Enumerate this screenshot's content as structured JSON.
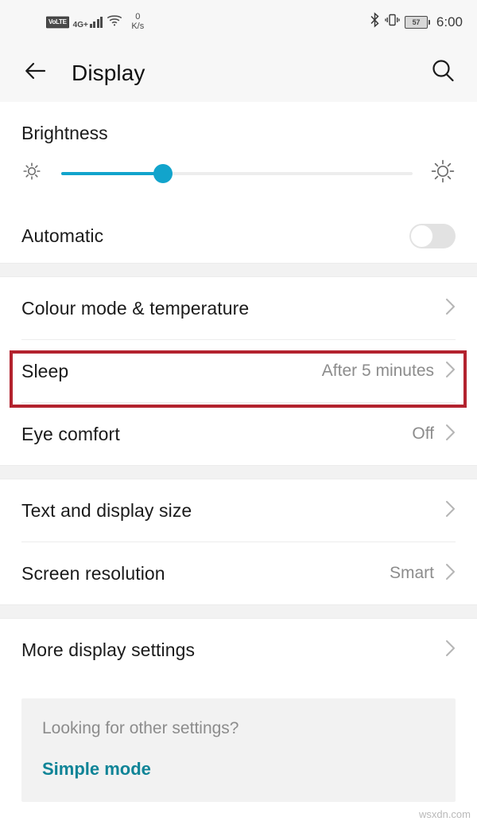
{
  "status_bar": {
    "volte_label": "VoLTE",
    "network_type": "4G+",
    "signal_icon": "signal-bars-icon",
    "wifi_icon": "wifi-icon",
    "network_speed_value": "0",
    "network_speed_unit": "K/s",
    "bluetooth_icon": "bluetooth-icon",
    "vibrate_icon": "vibrate-icon",
    "battery_percent": "57",
    "time": "6:00"
  },
  "app_bar": {
    "back_icon": "back-arrow-icon",
    "title": "Display",
    "search_icon": "search-icon"
  },
  "brightness": {
    "label": "Brightness",
    "low_icon": "brightness-low-sun-icon",
    "high_icon": "brightness-high-sun-icon",
    "slider_percent": 29
  },
  "automatic": {
    "label": "Automatic",
    "toggle_state": "off"
  },
  "group_2": [
    {
      "label": "Colour mode & temperature",
      "value": "",
      "chevron": "chevron-right-icon",
      "highlighted": false
    },
    {
      "label": "Sleep",
      "value": "After 5 minutes",
      "chevron": "chevron-right-icon",
      "highlighted": true
    },
    {
      "label": "Eye comfort",
      "value": "Off",
      "chevron": "chevron-right-icon",
      "highlighted": false
    }
  ],
  "group_3": [
    {
      "label": "Text and display size",
      "value": "",
      "chevron": "chevron-right-icon"
    },
    {
      "label": "Screen resolution",
      "value": "Smart",
      "chevron": "chevron-right-icon"
    }
  ],
  "group_4": [
    {
      "label": "More display settings",
      "value": "",
      "chevron": "chevron-right-icon"
    }
  ],
  "footer": {
    "question": "Looking for other settings?",
    "link_label": "Simple mode"
  },
  "watermark": "wsxdn.com",
  "colors": {
    "accent_slider": "#12a4cc",
    "link_teal": "#0f8497",
    "highlight_red": "#b3222e",
    "section_gap": "#f2f2f2",
    "app_bar_bg": "#f7f7f7"
  }
}
